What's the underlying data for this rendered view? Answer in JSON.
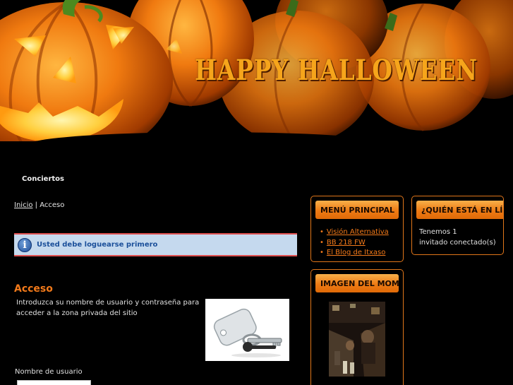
{
  "header": {
    "title": "HAPPY HALLOWEEN"
  },
  "nav": {
    "items": [
      {
        "label": "Conciertos"
      }
    ]
  },
  "breadcrumb": {
    "home": "Inicio",
    "separator": "|",
    "current": "Acceso"
  },
  "notice": {
    "icon": "info-icon",
    "text": "Usted debe loguearse primero"
  },
  "access": {
    "title": "Acceso",
    "description": "Introduzca su nombre de usuario y contraseña para acceder a la zona privada del sitio",
    "image_icon": "keys-image",
    "username_label": "Nombre de usuario",
    "username_value": ""
  },
  "sidebar": {
    "main_menu": {
      "title": "MENÚ PRINCIPAL",
      "items": [
        {
          "label": "Visión Alternativa"
        },
        {
          "label": "BB 218 FW"
        },
        {
          "label": "El Blog de Itxaso"
        }
      ]
    },
    "who_online": {
      "title": "¿QUIÉN ESTÁ EN LÍNEA?",
      "line1": "Tenemos 1",
      "line2": "invitado conectado(s)"
    },
    "image_of_moment": {
      "title": "IMAGEN DEL MOMENTO"
    }
  },
  "colors": {
    "accent": "#f37a1a",
    "module_header": "#ee7b14",
    "notice_bg": "#c5d9ee",
    "notice_border": "#e05050",
    "notice_text": "#1b4f9a"
  }
}
